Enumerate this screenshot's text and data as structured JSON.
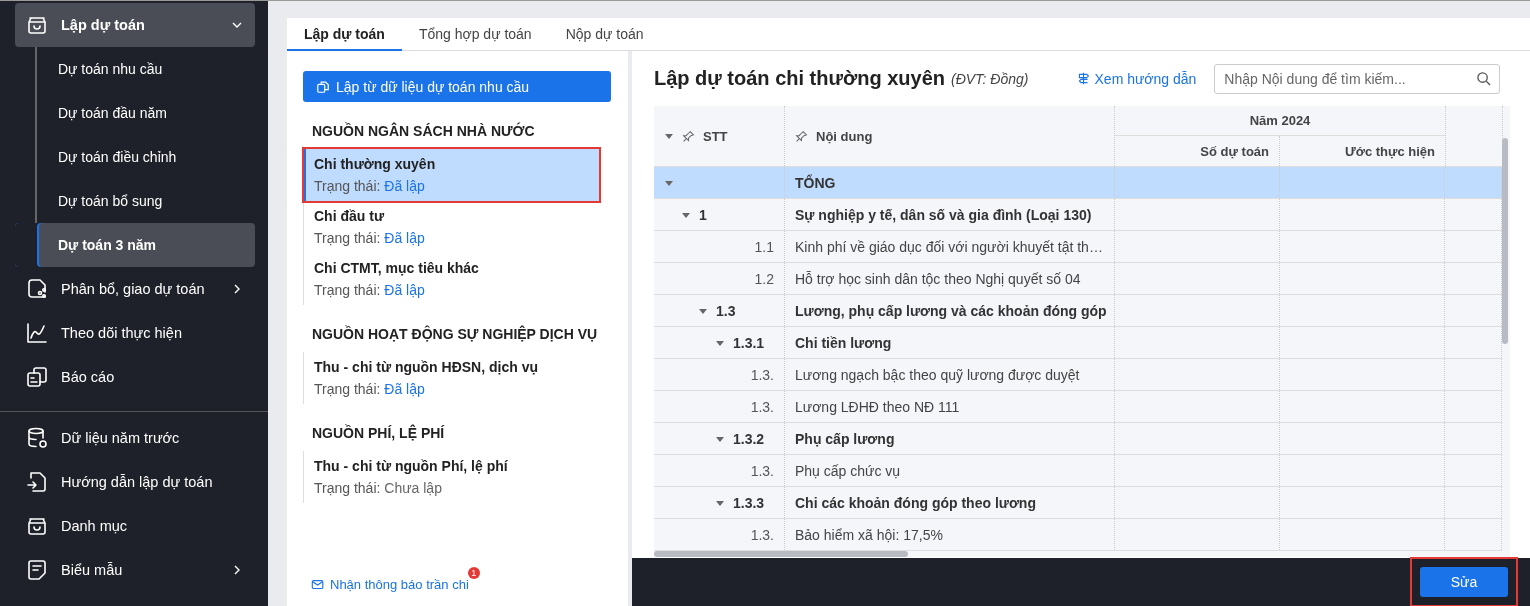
{
  "sidebar": {
    "groups": [
      {
        "items": [
          {
            "label": "Lập dự toán",
            "expanded": true,
            "children": [
              {
                "label": "Dự toán nhu cầu",
                "selected": false
              },
              {
                "label": "Dự toán đầu năm",
                "selected": false
              },
              {
                "label": "Dự toán điều chỉnh",
                "selected": false
              },
              {
                "label": "Dự toán bổ sung",
                "selected": false
              },
              {
                "label": "Dự toán 3 năm",
                "selected": true
              }
            ]
          },
          {
            "label": "Phân bổ, giao dự toán",
            "expanded": false
          },
          {
            "label": "Theo dõi thực hiện"
          },
          {
            "label": "Báo cáo"
          }
        ]
      },
      {
        "items": [
          {
            "label": "Dữ liệu năm trước"
          },
          {
            "label": "Hướng dẫn lập dự toán"
          },
          {
            "label": "Danh mục"
          },
          {
            "label": "Biểu mẫu",
            "expanded": false
          }
        ]
      }
    ]
  },
  "tabs": [
    {
      "label": "Lập dự toán",
      "selected": true
    },
    {
      "label": "Tổng hợp dự toán",
      "selected": false
    },
    {
      "label": "Nộp dự toán",
      "selected": false
    }
  ],
  "left_panel": {
    "create_button": "Lập từ dữ liệu dự toán nhu cầu",
    "sources": [
      {
        "title": "NGUỒN NGÂN SÁCH NHÀ NƯỚC",
        "items": [
          {
            "name": "Chi thường xuyên",
            "status_label": "Trạng thái:",
            "status": "Đã lập",
            "done": true,
            "selected": true,
            "highlighted": true
          },
          {
            "name": "Chi đầu tư",
            "status_label": "Trạng thái:",
            "status": "Đã lập",
            "done": true,
            "selected": false,
            "highlighted": false
          },
          {
            "name": "Chi CTMT, mục tiêu khác",
            "status_label": "Trạng thái:",
            "status": "Đã lập",
            "done": true,
            "selected": false,
            "highlighted": false
          }
        ]
      },
      {
        "title": "NGUỒN HOẠT ĐỘNG SỰ NGHIỆP DỊCH VỤ",
        "items": [
          {
            "name": "Thu - chi từ nguồn HĐSN, dịch vụ",
            "status_label": "Trạng thái:",
            "status": "Đã lập",
            "done": true,
            "selected": false,
            "highlighted": false
          }
        ]
      },
      {
        "title": "NGUỒN PHÍ, LỆ PHÍ",
        "items": [
          {
            "name": "Thu - chi từ nguồn Phí, lệ phí",
            "status_label": "Trạng thái:",
            "status": "Chưa lập",
            "done": false,
            "selected": false,
            "highlighted": false
          }
        ]
      }
    ],
    "notice_link": {
      "label": "Nhận thông báo trần chi",
      "badge": "1"
    }
  },
  "content": {
    "title": "Lập dự toán chi thường xuyên",
    "unit": "(ĐVT: Đồng)",
    "guide_link": "Xem hướng dẫn",
    "search": {
      "placeholder": "Nhập Nội dung để tìm kiếm..."
    },
    "table": {
      "columns": {
        "stt": "STT",
        "content": "Nội dung",
        "year_group": "Năm 2024",
        "estimate": "Số dự toán",
        "actual": "Ước thực hiện"
      },
      "rows": [
        {
          "stt": "",
          "content": "TỔNG",
          "selected": true,
          "expanded": true,
          "children": [
            {
              "stt": "1",
              "content": "Sự nghiệp y tế, dân số và gia đình (Loại 130)",
              "selected": false,
              "expanded": true,
              "children": [
                {
                  "stt": "1.1",
                  "content": "Kinh phí về giáo dục đối với người khuyết tật th…",
                  "selected": false
                },
                {
                  "stt": "1.2",
                  "content": "Hỗ trợ học sinh dân tộc theo Nghị quyết số 04",
                  "selected": false
                },
                {
                  "stt": "1.3",
                  "content": "Lương, phụ cấp lương và các khoản đóng góp",
                  "selected": false,
                  "expanded": true,
                  "children": [
                    {
                      "stt": "1.3.1",
                      "content": "Chi tiền lương",
                      "selected": false,
                      "expanded": true,
                      "children": [
                        {
                          "stt": "1.3.",
                          "content": "Lương ngạch bậc theo quỹ lương được duyệt",
                          "selected": false
                        },
                        {
                          "stt": "1.3.",
                          "content": "Lương LĐHĐ theo NĐ 111",
                          "selected": false
                        }
                      ]
                    },
                    {
                      "stt": "1.3.2",
                      "content": "Phụ cấp lương",
                      "selected": false,
                      "expanded": true,
                      "children": [
                        {
                          "stt": "1.3.",
                          "content": "Phụ cấp chức vụ",
                          "selected": false
                        }
                      ]
                    },
                    {
                      "stt": "1.3.3",
                      "content": "Chi các khoản đóng góp theo lương",
                      "selected": false,
                      "expanded": true,
                      "children": [
                        {
                          "stt": "1.3.",
                          "content": "Bảo hiểm xã hội: 17,5%",
                          "selected": false
                        }
                      ]
                    }
                  ]
                }
              ]
            }
          ]
        }
      ]
    }
  },
  "footer": {
    "edit_button": {
      "label": "Sửa",
      "highlighted": true
    }
  }
}
